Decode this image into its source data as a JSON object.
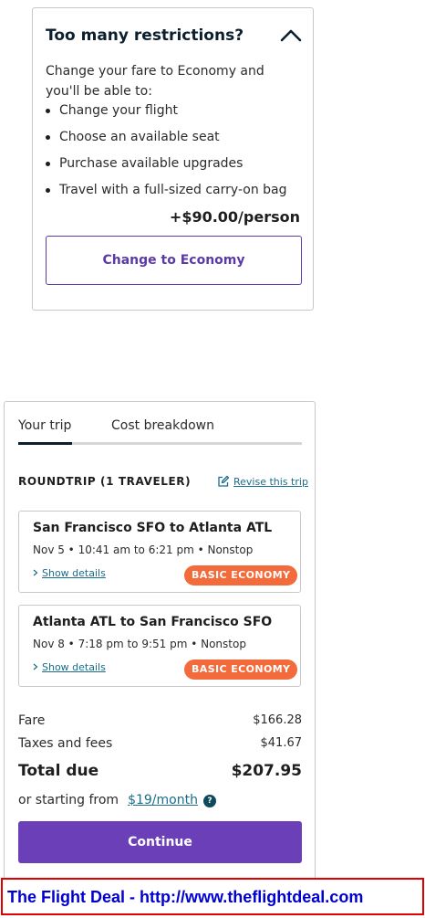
{
  "upsell": {
    "title": "Too many restrictions?",
    "toggle_icon": "chevron-up-icon",
    "intro": "Change your fare to Economy and you'll be able to:",
    "benefits": [
      "Change your flight",
      "Choose an available seat",
      "Purchase available upgrades",
      "Travel with a full-sized carry-on bag"
    ],
    "price": "+$90.00/person",
    "button_label": "Change to Economy",
    "accent_color": "#5b3aa8"
  },
  "trip": {
    "tabs": [
      {
        "label": "Your trip",
        "active": true
      },
      {
        "label": "Cost breakdown",
        "active": false
      }
    ],
    "roundtrip_label": "ROUNDTRIP (1 TRAVELER)",
    "revise_label": "Revise this trip",
    "revise_icon": "edit-icon",
    "segments": [
      {
        "route": "San Francisco SFO to Atlanta ATL",
        "times": "Nov 5 • 10:41 am to 6:21 pm • Nonstop",
        "details_label": "Show details",
        "fare_badge": "BASIC ECONOMY"
      },
      {
        "route": "Atlanta ATL to San Francisco SFO",
        "times": "Nov 8 • 7:18 pm to 9:51 pm • Nonstop",
        "details_label": "Show details",
        "fare_badge": "BASIC ECONOMY"
      }
    ],
    "fare_label": "Fare",
    "fare_amount": "$166.28",
    "taxes_label": "Taxes and fees",
    "taxes_amount": "$41.67",
    "total_label": "Total due",
    "total_amount": "$207.95",
    "monthly_prefix": "or starting from",
    "monthly_link": "$19/month",
    "help_icon_glyph": "?",
    "continue_label": "Continue",
    "badge_color": "#f36b3b",
    "primary_color": "#6a3fb8"
  },
  "watermark": {
    "text": "The Flight Deal - http://www.theflightdeal.com",
    "border_color": "#e00000",
    "text_color": "#0000d0"
  }
}
